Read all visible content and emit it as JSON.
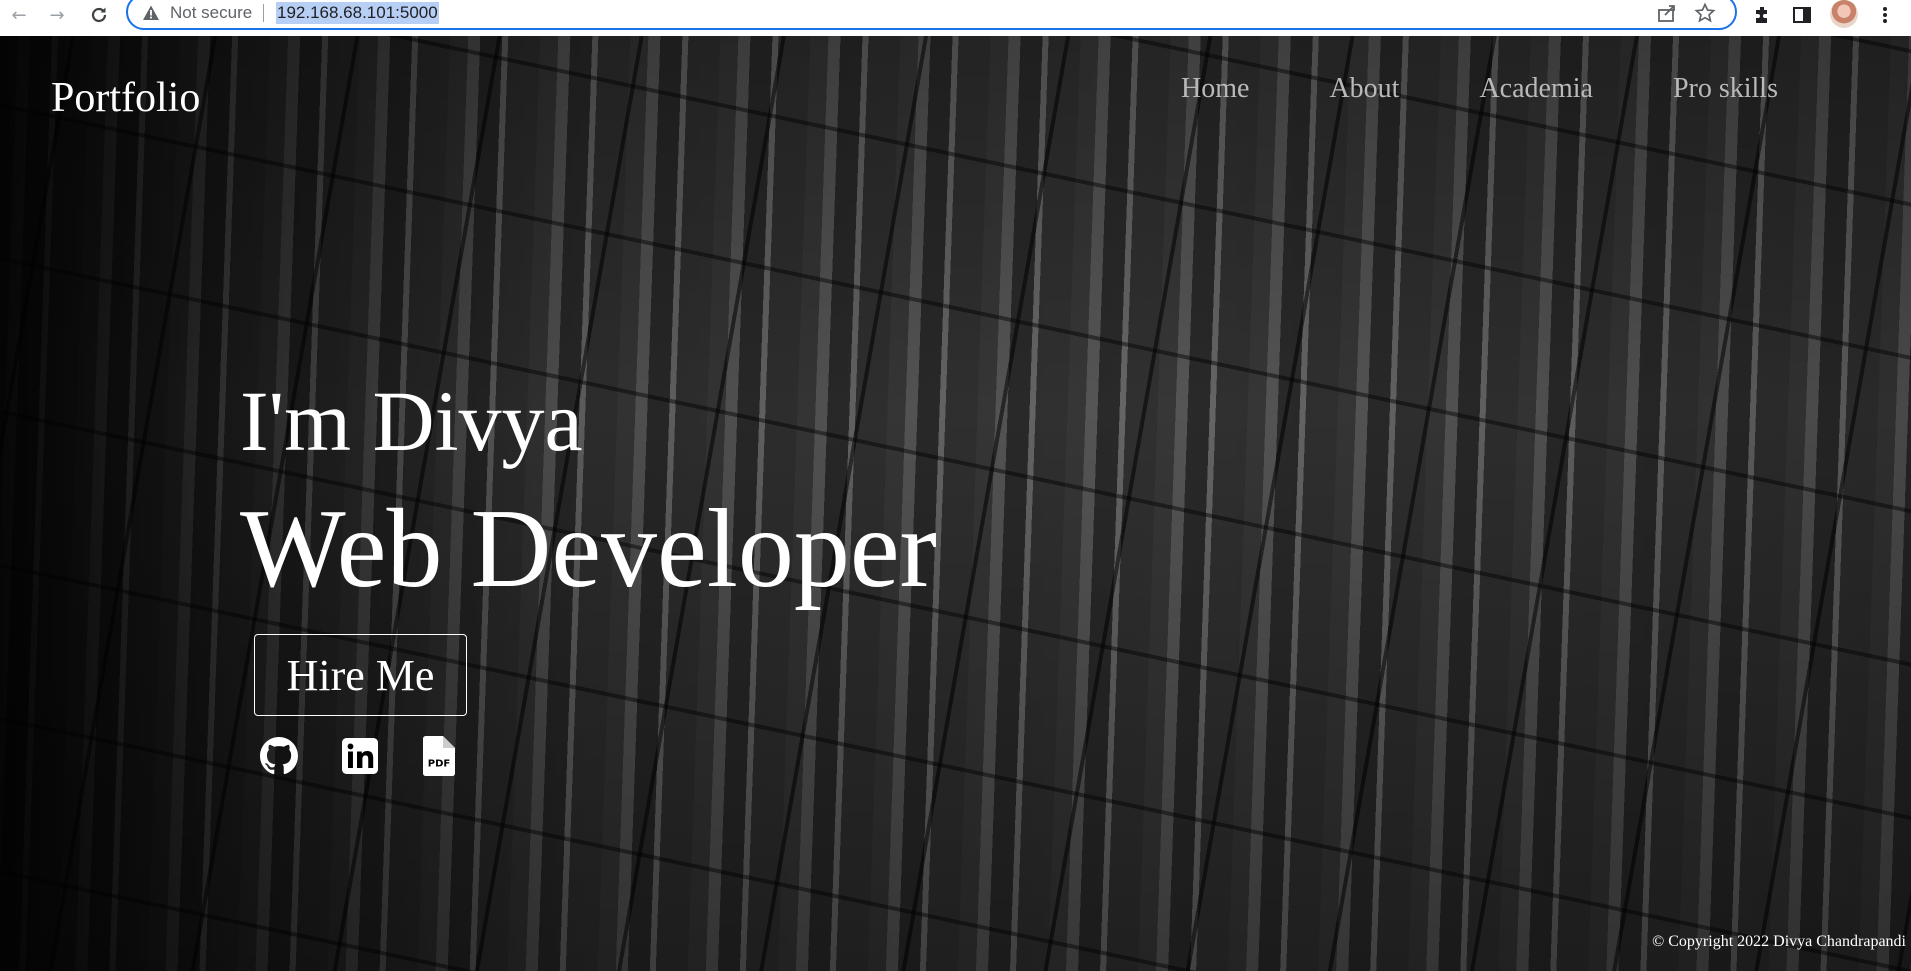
{
  "browser": {
    "security_label": "Not secure",
    "url": "192.168.68.101:5000",
    "icons": [
      "back-icon",
      "forward-icon",
      "reload-icon",
      "warning-icon",
      "share-icon",
      "star-icon",
      "extensions-icon",
      "side-panel-icon",
      "profile-avatar",
      "menu-icon"
    ]
  },
  "site": {
    "brand": "Portfolio",
    "nav": [
      "Home",
      "About",
      "Academia",
      "Pro skills"
    ],
    "hero": {
      "intro": "I'm Divya",
      "role": "Web Developer",
      "cta": "Hire Me"
    },
    "social": [
      "github-icon",
      "linkedin-icon",
      "pdf-icon"
    ],
    "footer": "© Copyright 2022 Divya Chandrapandi"
  },
  "colors": {
    "text": "#ffffff",
    "nav_text": "#b9b9b9",
    "omnibox_border": "#1a73e8",
    "url_highlight": "#b8cff5"
  }
}
